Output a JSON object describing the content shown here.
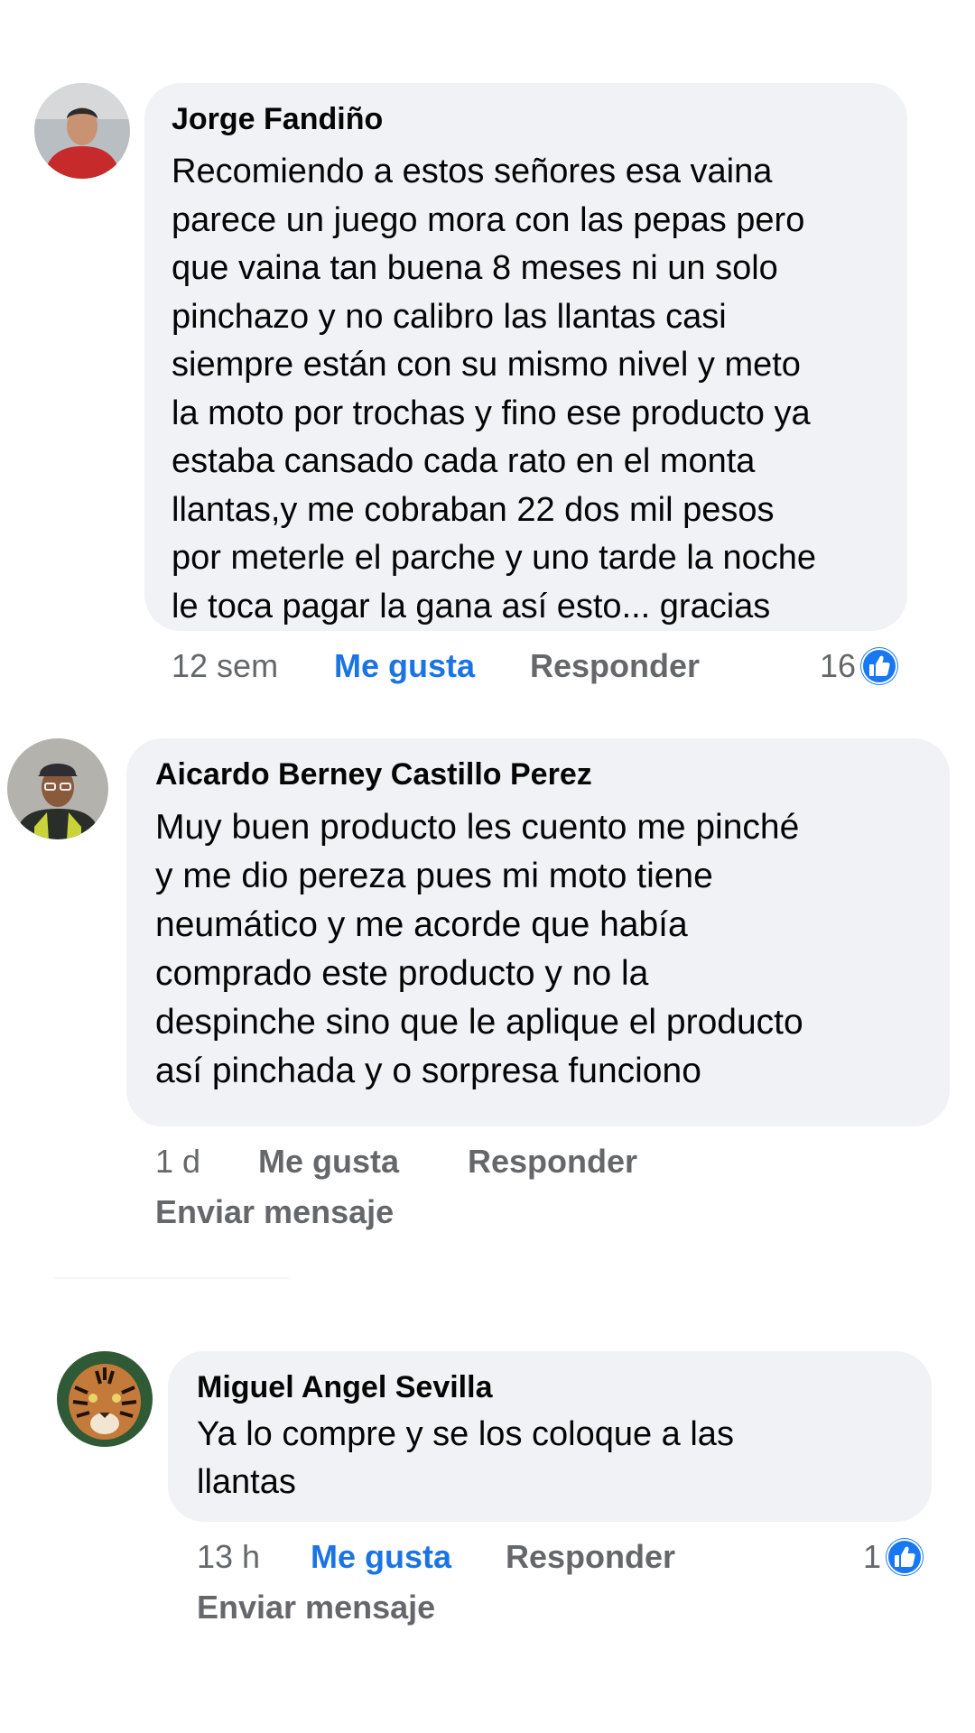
{
  "colors": {
    "bubble_bg": "#f0f2f5",
    "meta_text": "#65676b",
    "accent_blue": "#1b74e4",
    "like_icon_blue": "#1877f2"
  },
  "comments": [
    {
      "author": "Jorge Fandiño",
      "text": "Recomiendo a estos señores esa vaina\nparece un juego mora con las pepas pero\nque vaina tan buena 8 meses ni un solo\npinchazo y no calibro las llantas casi\nsiempre están con su mismo nivel y meto\nla moto por trochas y fino ese producto ya\nestaba cansado cada rato en el monta\nllantas,y me cobraban 22 dos mil pesos\npor meterle el parche y uno tarde la noche\nle toca pagar la gana así esto... gracias",
      "time": "12 sem",
      "like_label": "Me gusta",
      "liked": true,
      "reply_label": "Responder",
      "reaction_count": "16",
      "reaction_icon": "like-icon"
    },
    {
      "author": "Aicardo Berney Castillo Perez",
      "text": "Muy buen producto les cuento me pinché\ny me dio pereza pues mi moto tiene\nneumático y me acorde que había\ncomprado este producto y no la\ndespinche sino que le aplique el producto\nasí pinchada y o sorpresa funciono",
      "time": "1 d",
      "like_label": "Me gusta",
      "liked": false,
      "reply_label": "Responder",
      "send_label": "Enviar mensaje"
    },
    {
      "author": "Miguel Angel Sevilla",
      "text": "Ya lo compre y se los coloque a las\nllantas",
      "time": "13 h",
      "like_label": "Me gusta",
      "liked": true,
      "reply_label": "Responder",
      "reaction_count": "1",
      "reaction_icon": "like-icon",
      "send_label": "Enviar mensaje"
    }
  ]
}
